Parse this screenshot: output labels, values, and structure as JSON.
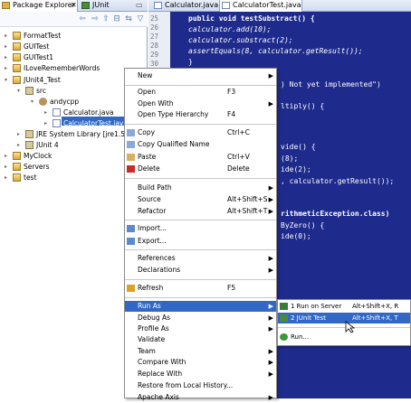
{
  "package_explorer": {
    "tabs": [
      "Package Explorer",
      "JUnit"
    ],
    "tree": [
      {
        "label": "FormatTest",
        "level": 0,
        "icon": "project-icon",
        "toggle": "+"
      },
      {
        "label": "GUITest",
        "level": 0,
        "icon": "project-icon",
        "toggle": "+"
      },
      {
        "label": "GUITest1",
        "level": 0,
        "icon": "project-icon",
        "toggle": "+"
      },
      {
        "label": "ILoveRememberWords",
        "level": 0,
        "icon": "project-icon",
        "toggle": "+"
      },
      {
        "label": "JUnit4_Test",
        "level": 0,
        "icon": "project-icon",
        "toggle": "-"
      },
      {
        "label": "src",
        "level": 1,
        "icon": "source-folder-icon",
        "toggle": "-"
      },
      {
        "label": "andycpp",
        "level": 2,
        "icon": "package-icon",
        "toggle": "-"
      },
      {
        "label": "Calculator.java",
        "level": 3,
        "icon": "java-file-icon",
        "toggle": "+"
      },
      {
        "label": "CalculatorTest.java",
        "level": 3,
        "icon": "java-file-icon",
        "toggle": "+",
        "selected": true
      },
      {
        "label": "JRE System Library [jre1.5",
        "level": 1,
        "icon": "library-icon",
        "toggle": "+"
      },
      {
        "label": "JUnit 4",
        "level": 1,
        "icon": "library-icon",
        "toggle": "+"
      },
      {
        "label": "MyClock",
        "level": 0,
        "icon": "project-icon",
        "toggle": "+"
      },
      {
        "label": "Servers",
        "level": 0,
        "icon": "project-icon",
        "toggle": "+"
      },
      {
        "label": "test",
        "level": 0,
        "icon": "project-icon",
        "toggle": "+"
      }
    ]
  },
  "editor": {
    "tabs": [
      "Calculator.java",
      "CalculatorTest.java"
    ],
    "line_numbers": [
      "25",
      "26",
      "27",
      "28",
      "29",
      "30"
    ],
    "code_lines": [
      "public void testSubstract() {",
      "    calculator.add(10);",
      "    calculator.substract(2);",
      "    assertEquals(8, calculator.getResult());",
      "}"
    ],
    "fragments": [
      ") Not yet implemented\")",
      "ltiply() {",
      "vide() {",
      "(8);",
      "ide(2);",
      ", calculator.getResult());",
      "rithmeticException.class)",
      "ByZero() {",
      "ide(0);"
    ]
  },
  "context_menu": {
    "items": [
      {
        "label": "New",
        "shortcut": "",
        "arrow": true
      },
      {
        "label": "Open",
        "shortcut": "F3"
      },
      {
        "label": "Open With",
        "shortcut": "",
        "arrow": true
      },
      {
        "label": "Open Type Hierarchy",
        "shortcut": "F4"
      },
      {
        "label": "Copy",
        "shortcut": "Ctrl+C",
        "icon": "copy-icon"
      },
      {
        "label": "Copy Qualified Name",
        "shortcut": "",
        "icon": "copy-icon"
      },
      {
        "label": "Paste",
        "shortcut": "Ctrl+V",
        "icon": "paste-icon"
      },
      {
        "label": "Delete",
        "shortcut": "Delete",
        "icon": "delete-icon"
      },
      {
        "label": "Build Path",
        "shortcut": "",
        "arrow": true
      },
      {
        "label": "Source",
        "shortcut": "Alt+Shift+S",
        "arrow": true
      },
      {
        "label": "Refactor",
        "shortcut": "Alt+Shift+T",
        "arrow": true
      },
      {
        "label": "Import...",
        "shortcut": "",
        "icon": "import-icon"
      },
      {
        "label": "Export...",
        "shortcut": "",
        "icon": "export-icon"
      },
      {
        "label": "References",
        "shortcut": "",
        "arrow": true
      },
      {
        "label": "Declarations",
        "shortcut": "",
        "arrow": true
      },
      {
        "label": "Refresh",
        "shortcut": "F5",
        "icon": "refresh-icon"
      },
      {
        "label": "Run As",
        "shortcut": "",
        "arrow": true,
        "highlighted": true
      },
      {
        "label": "Debug As",
        "shortcut": "",
        "arrow": true
      },
      {
        "label": "Profile As",
        "shortcut": "",
        "arrow": true
      },
      {
        "label": "Validate",
        "shortcut": ""
      },
      {
        "label": "Team",
        "shortcut": "",
        "arrow": true
      },
      {
        "label": "Compare With",
        "shortcut": "",
        "arrow": true
      },
      {
        "label": "Replace With",
        "shortcut": "",
        "arrow": true
      },
      {
        "label": "Restore from Local History...",
        "shortcut": ""
      },
      {
        "label": "Apache Axis",
        "shortcut": "",
        "arrow": true
      }
    ]
  },
  "run_as_submenu": {
    "items": [
      {
        "label": "1 Run on Server",
        "shortcut": "Alt+Shift+X, R",
        "icon": "server-icon"
      },
      {
        "label": "2 JUnit Test",
        "shortcut": "Alt+Shift+X, T",
        "icon": "junit-icon",
        "highlighted": true
      },
      {
        "label": "Run...",
        "shortcut": "",
        "icon": "run-icon"
      }
    ]
  }
}
